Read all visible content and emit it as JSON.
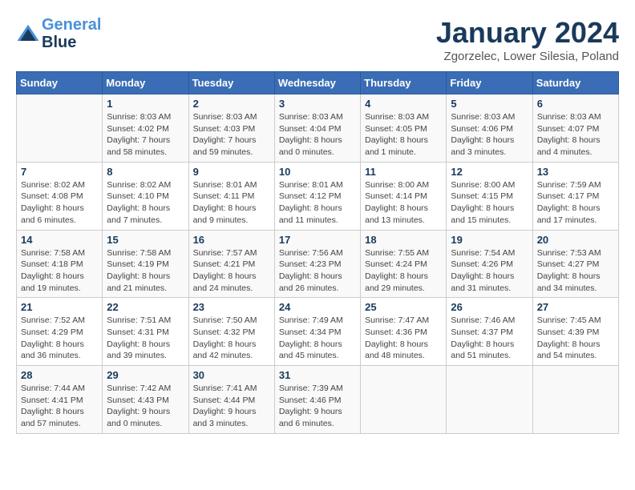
{
  "header": {
    "logo_line1": "General",
    "logo_line2": "Blue",
    "title": "January 2024",
    "subtitle": "Zgorzelec, Lower Silesia, Poland"
  },
  "columns": [
    "Sunday",
    "Monday",
    "Tuesday",
    "Wednesday",
    "Thursday",
    "Friday",
    "Saturday"
  ],
  "weeks": [
    [
      {
        "day": "",
        "info": ""
      },
      {
        "day": "1",
        "info": "Sunrise: 8:03 AM\nSunset: 4:02 PM\nDaylight: 7 hours\nand 58 minutes."
      },
      {
        "day": "2",
        "info": "Sunrise: 8:03 AM\nSunset: 4:03 PM\nDaylight: 7 hours\nand 59 minutes."
      },
      {
        "day": "3",
        "info": "Sunrise: 8:03 AM\nSunset: 4:04 PM\nDaylight: 8 hours\nand 0 minutes."
      },
      {
        "day": "4",
        "info": "Sunrise: 8:03 AM\nSunset: 4:05 PM\nDaylight: 8 hours\nand 1 minute."
      },
      {
        "day": "5",
        "info": "Sunrise: 8:03 AM\nSunset: 4:06 PM\nDaylight: 8 hours\nand 3 minutes."
      },
      {
        "day": "6",
        "info": "Sunrise: 8:03 AM\nSunset: 4:07 PM\nDaylight: 8 hours\nand 4 minutes."
      }
    ],
    [
      {
        "day": "7",
        "info": "Sunrise: 8:02 AM\nSunset: 4:08 PM\nDaylight: 8 hours\nand 6 minutes."
      },
      {
        "day": "8",
        "info": "Sunrise: 8:02 AM\nSunset: 4:10 PM\nDaylight: 8 hours\nand 7 minutes."
      },
      {
        "day": "9",
        "info": "Sunrise: 8:01 AM\nSunset: 4:11 PM\nDaylight: 8 hours\nand 9 minutes."
      },
      {
        "day": "10",
        "info": "Sunrise: 8:01 AM\nSunset: 4:12 PM\nDaylight: 8 hours\nand 11 minutes."
      },
      {
        "day": "11",
        "info": "Sunrise: 8:00 AM\nSunset: 4:14 PM\nDaylight: 8 hours\nand 13 minutes."
      },
      {
        "day": "12",
        "info": "Sunrise: 8:00 AM\nSunset: 4:15 PM\nDaylight: 8 hours\nand 15 minutes."
      },
      {
        "day": "13",
        "info": "Sunrise: 7:59 AM\nSunset: 4:17 PM\nDaylight: 8 hours\nand 17 minutes."
      }
    ],
    [
      {
        "day": "14",
        "info": "Sunrise: 7:58 AM\nSunset: 4:18 PM\nDaylight: 8 hours\nand 19 minutes."
      },
      {
        "day": "15",
        "info": "Sunrise: 7:58 AM\nSunset: 4:19 PM\nDaylight: 8 hours\nand 21 minutes."
      },
      {
        "day": "16",
        "info": "Sunrise: 7:57 AM\nSunset: 4:21 PM\nDaylight: 8 hours\nand 24 minutes."
      },
      {
        "day": "17",
        "info": "Sunrise: 7:56 AM\nSunset: 4:23 PM\nDaylight: 8 hours\nand 26 minutes."
      },
      {
        "day": "18",
        "info": "Sunrise: 7:55 AM\nSunset: 4:24 PM\nDaylight: 8 hours\nand 29 minutes."
      },
      {
        "day": "19",
        "info": "Sunrise: 7:54 AM\nSunset: 4:26 PM\nDaylight: 8 hours\nand 31 minutes."
      },
      {
        "day": "20",
        "info": "Sunrise: 7:53 AM\nSunset: 4:27 PM\nDaylight: 8 hours\nand 34 minutes."
      }
    ],
    [
      {
        "day": "21",
        "info": "Sunrise: 7:52 AM\nSunset: 4:29 PM\nDaylight: 8 hours\nand 36 minutes."
      },
      {
        "day": "22",
        "info": "Sunrise: 7:51 AM\nSunset: 4:31 PM\nDaylight: 8 hours\nand 39 minutes."
      },
      {
        "day": "23",
        "info": "Sunrise: 7:50 AM\nSunset: 4:32 PM\nDaylight: 8 hours\nand 42 minutes."
      },
      {
        "day": "24",
        "info": "Sunrise: 7:49 AM\nSunset: 4:34 PM\nDaylight: 8 hours\nand 45 minutes."
      },
      {
        "day": "25",
        "info": "Sunrise: 7:47 AM\nSunset: 4:36 PM\nDaylight: 8 hours\nand 48 minutes."
      },
      {
        "day": "26",
        "info": "Sunrise: 7:46 AM\nSunset: 4:37 PM\nDaylight: 8 hours\nand 51 minutes."
      },
      {
        "day": "27",
        "info": "Sunrise: 7:45 AM\nSunset: 4:39 PM\nDaylight: 8 hours\nand 54 minutes."
      }
    ],
    [
      {
        "day": "28",
        "info": "Sunrise: 7:44 AM\nSunset: 4:41 PM\nDaylight: 8 hours\nand 57 minutes."
      },
      {
        "day": "29",
        "info": "Sunrise: 7:42 AM\nSunset: 4:43 PM\nDaylight: 9 hours\nand 0 minutes."
      },
      {
        "day": "30",
        "info": "Sunrise: 7:41 AM\nSunset: 4:44 PM\nDaylight: 9 hours\nand 3 minutes."
      },
      {
        "day": "31",
        "info": "Sunrise: 7:39 AM\nSunset: 4:46 PM\nDaylight: 9 hours\nand 6 minutes."
      },
      {
        "day": "",
        "info": ""
      },
      {
        "day": "",
        "info": ""
      },
      {
        "day": "",
        "info": ""
      }
    ]
  ]
}
